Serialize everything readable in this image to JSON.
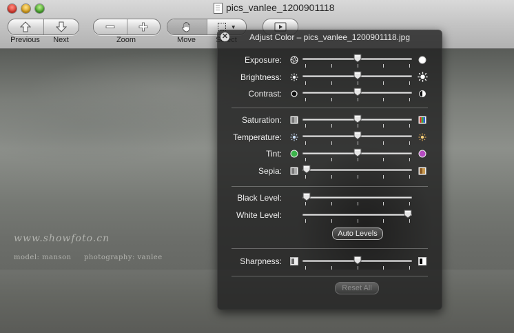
{
  "window": {
    "title": "pics_vanlee_1200901118"
  },
  "toolbar": {
    "previous_label": "Previous",
    "next_label": "Next",
    "zoom_label": "Zoom",
    "move_label": "Move",
    "select_label": "Select"
  },
  "photo": {
    "watermark": "www.showfoto.cn",
    "credits": "model: manson     photography: vanlee"
  },
  "adjust_panel": {
    "title": "Adjust Color – pics_vanlee_1200901118.jpg",
    "sliders": {
      "exposure": {
        "label": "Exposure:",
        "value": 0.5
      },
      "brightness": {
        "label": "Brightness:",
        "value": 0.5
      },
      "contrast": {
        "label": "Contrast:",
        "value": 0.5
      },
      "saturation": {
        "label": "Saturation:",
        "value": 0.5
      },
      "temperature": {
        "label": "Temperature:",
        "value": 0.5
      },
      "tint": {
        "label": "Tint:",
        "value": 0.5
      },
      "sepia": {
        "label": "Sepia:",
        "value": 0.0
      },
      "black_level": {
        "label": "Black Level:",
        "value": 0.0
      },
      "white_level": {
        "label": "White Level:",
        "value": 1.0
      },
      "sharpness": {
        "label": "Sharpness:",
        "value": 0.5
      }
    },
    "auto_levels_label": "Auto Levels",
    "reset_all_label": "Reset All"
  },
  "colors": {
    "hud_background": "#202020",
    "tint_left": "#3bb44a",
    "tint_right": "#b64bc1"
  }
}
